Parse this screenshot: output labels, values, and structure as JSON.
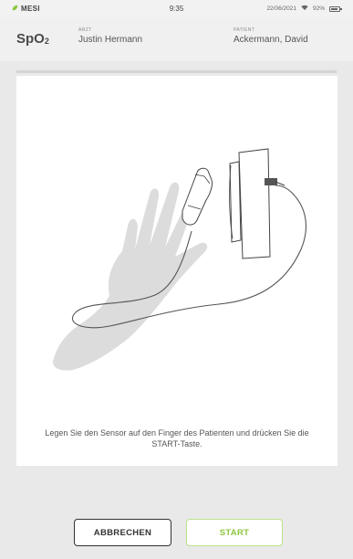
{
  "statusbar": {
    "brand": "MESI",
    "time": "9:35",
    "date": "22/06/2021",
    "battery": "92%",
    "battery_level": 0.92,
    "icons": [
      "leaf-icon",
      "wifi-icon",
      "battery-icon"
    ]
  },
  "header": {
    "mode": "SpO",
    "mode_subscript": "2",
    "doctor_label": "ARZT",
    "doctor_name": "Justin Hermann",
    "patient_label": "PATIENT",
    "patient_name": "Ackermann, David"
  },
  "main": {
    "instruction": "Legen Sie den Sensor auf den Finger des Patienten und drücken Sie die START-Taste."
  },
  "actions": {
    "cancel_label": "ABBRECHEN",
    "start_label": "START"
  },
  "colors": {
    "brand_green": "#8cc63f",
    "start_border": "#b9e08a",
    "cancel_border": "#333333",
    "background": "#e9e9e9",
    "card": "#ffffff"
  }
}
